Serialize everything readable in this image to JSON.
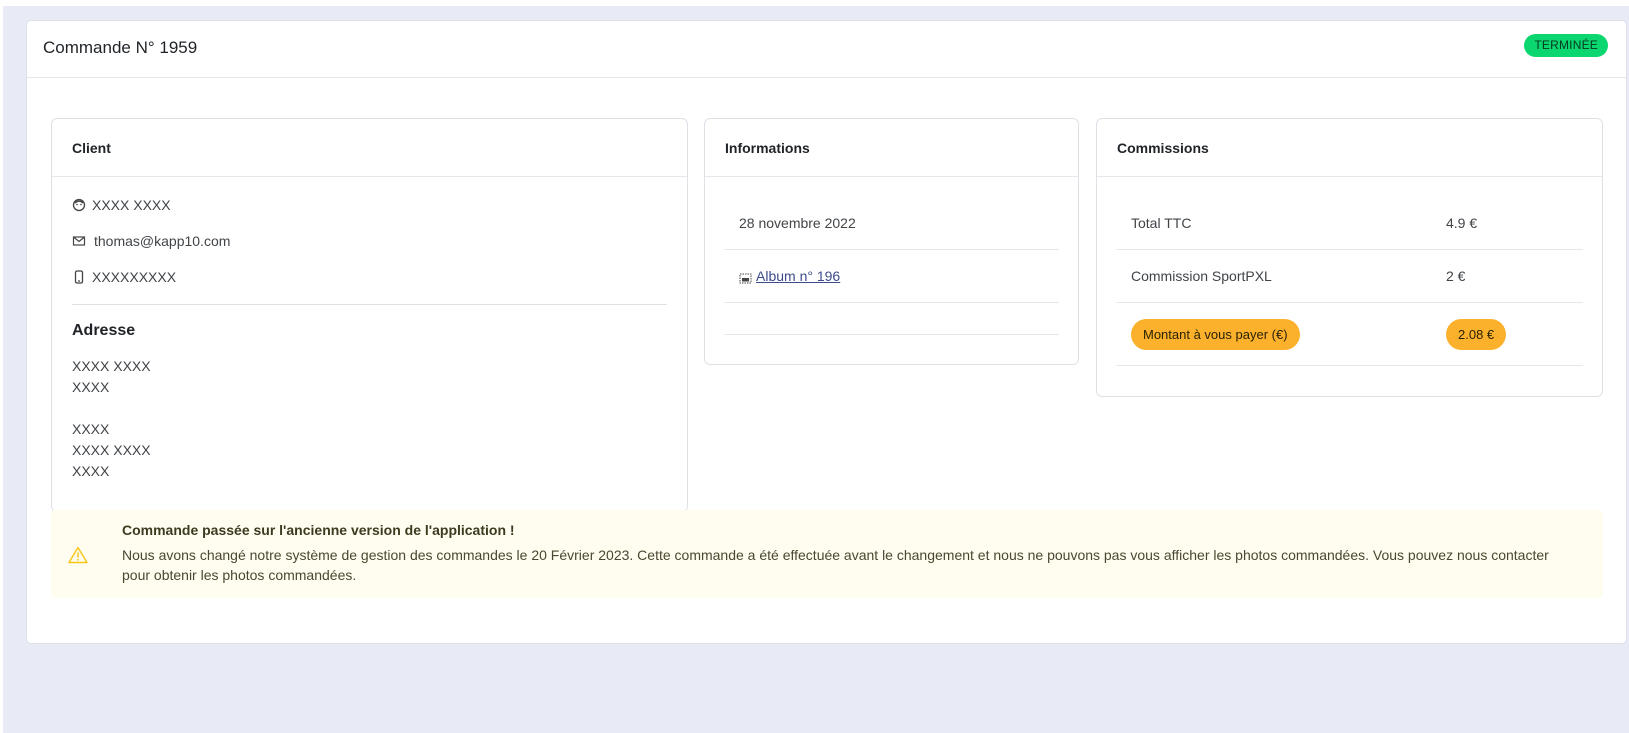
{
  "order": {
    "title": "Commande N° 1959",
    "status": "TERMINÉE"
  },
  "client": {
    "heading": "Client",
    "name": "XXXX XXXX",
    "email": "thomas@kapp10.com",
    "phone": "XXXXXXXXX",
    "address_heading": "Adresse",
    "address_lines_a": [
      "XXXX XXXX",
      "XXXX"
    ],
    "address_lines_b": [
      "XXXX",
      "XXXX XXXX",
      "XXXX"
    ]
  },
  "informations": {
    "heading": "Informations",
    "date": "28 novembre 2022",
    "album_link": "Album n° 196"
  },
  "commissions": {
    "heading": "Commissions",
    "rows": [
      {
        "label": "Total TTC",
        "value": "4.9 €"
      },
      {
        "label": "Commission SportPXL",
        "value": "2 €"
      }
    ],
    "total_label": "Montant à vous payer (€)",
    "total_value": "2.08 €"
  },
  "notice": {
    "title": "Commande passée sur l'ancienne version de l'application !",
    "text": "Nous avons changé notre système de gestion des commandes le 20 Février 2023. Cette commande a été effectuée avant le changement et nous ne pouvons pas vous afficher les photos commandées. Vous pouvez nous contacter pour obtenir les photos commandées."
  },
  "colors": {
    "status_badge": "#0bd66f",
    "total_pill": "#fbb12b",
    "page_background": "#e8eaf6",
    "notice_background": "#fffdef"
  }
}
